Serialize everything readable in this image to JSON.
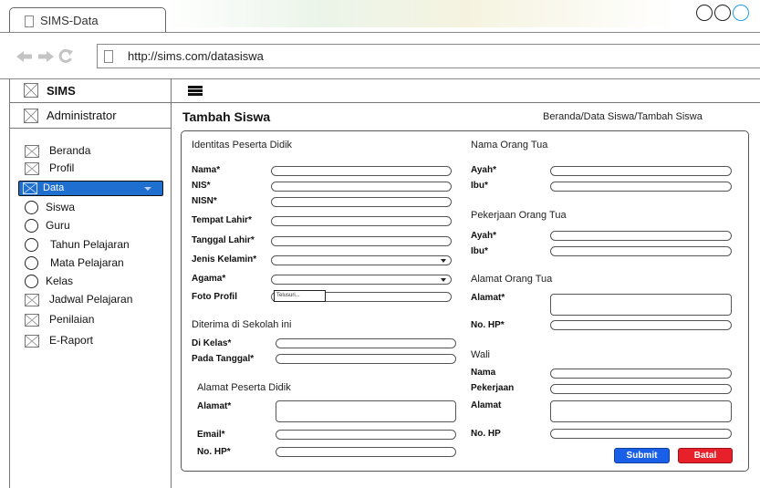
{
  "browser": {
    "tab_title": "SIMS-Data",
    "url": "http://sims.com/datasiswa"
  },
  "sidebar": {
    "brand": "SIMS",
    "user": "Administrator",
    "items": [
      {
        "label": "Beranda",
        "icon": "image-placeholder-icon"
      },
      {
        "label": "Profil",
        "icon": "image-placeholder-icon"
      },
      {
        "label": "Data",
        "icon": "image-placeholder-icon",
        "active": true
      },
      {
        "label": "Siswa",
        "icon": "circle-icon"
      },
      {
        "label": "Guru",
        "icon": "circle-icon"
      },
      {
        "label": "Tahun Pelajaran",
        "icon": "circle-icon"
      },
      {
        "label": "Mata Pelajaran",
        "icon": "circle-icon"
      },
      {
        "label": "Kelas",
        "icon": "circle-icon"
      },
      {
        "label": "Jadwal Pelajaran",
        "icon": "image-placeholder-icon"
      },
      {
        "label": "Penilaian",
        "icon": "image-placeholder-icon"
      },
      {
        "label": "E-Raport",
        "icon": "image-placeholder-icon"
      }
    ]
  },
  "header": {
    "page_title": "Tambah Siswa",
    "breadcrumb": "Beranda/Data Siswa/Tambah Siswa"
  },
  "form": {
    "left": {
      "identitas_title": "Identitas Peserta Didik",
      "nama": "Nama*",
      "nis": "NIS*",
      "nisn": "NISN*",
      "tempat_lahir": "Tempat Lahir*",
      "tanggal_lahir": "Tanggal Lahir*",
      "jenis_kelamin": "Jenis Kelamin*",
      "agama": "Agama*",
      "foto_profil": "Foto Profil",
      "telusuri": "Telusuri...",
      "diterima_title": "Diterima di Sekolah ini",
      "di_kelas": "Di Kelas*",
      "pada_tanggal": "Pada Tanggal*",
      "alamat_title": "Alamat Peserta Didik",
      "alamat": "Alamat*",
      "email": "Email*",
      "no_hp": "No. HP*"
    },
    "right": {
      "nama_ortu_title": "Nama Orang Tua",
      "ayah": "Ayah*",
      "ibu": "Ibu*",
      "pekerjaan_title": "Pekerjaan Orang Tua",
      "ayah2": "Ayah*",
      "ibu2": "Ibu*",
      "alamat_ortu_title": "Alamat Orang Tua",
      "alamat": "Alamat*",
      "no_hp": "No. HP*",
      "wali_title": "Wali",
      "wali_nama": "Nama",
      "wali_pekerjaan": "Pekerjaan",
      "wali_alamat": "Alamat",
      "wali_no_hp": "No. HP"
    },
    "buttons": {
      "submit": "Submit",
      "batal": "Batal"
    }
  },
  "colors": {
    "accent": "#1f6fd1",
    "submit": "#1a5fe8",
    "batal": "#e8202a",
    "watermark": "#dfeedd"
  }
}
